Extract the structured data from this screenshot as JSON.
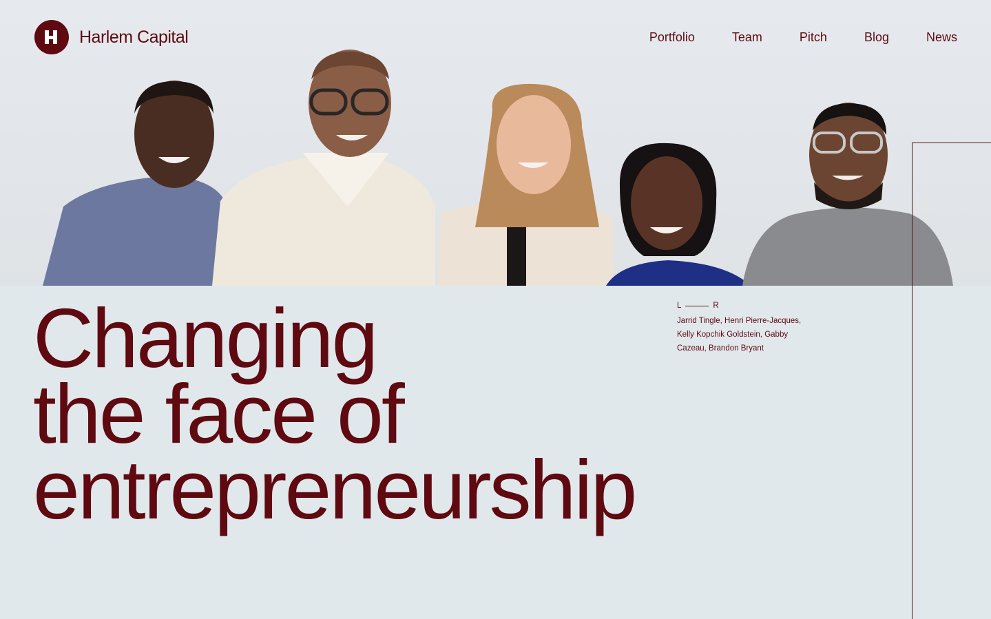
{
  "brand": {
    "name": "Harlem Capital",
    "color": "#5e0a10"
  },
  "nav": {
    "items": [
      {
        "label": "Portfolio"
      },
      {
        "label": "Team"
      },
      {
        "label": "Pitch"
      },
      {
        "label": "Blog"
      },
      {
        "label": "News"
      }
    ]
  },
  "hero": {
    "headline": [
      "Changing",
      "the face of",
      "entrepreneurship"
    ]
  },
  "caption": {
    "left": "L",
    "right": "R",
    "names": "Jarrid Tingle, Henri Pierre-Jacques, Kelly Kopchik Goldstein, Gabby Cazeau, Brandon Bryant"
  },
  "icons": {
    "logo": "h-monogram-logo-icon"
  }
}
